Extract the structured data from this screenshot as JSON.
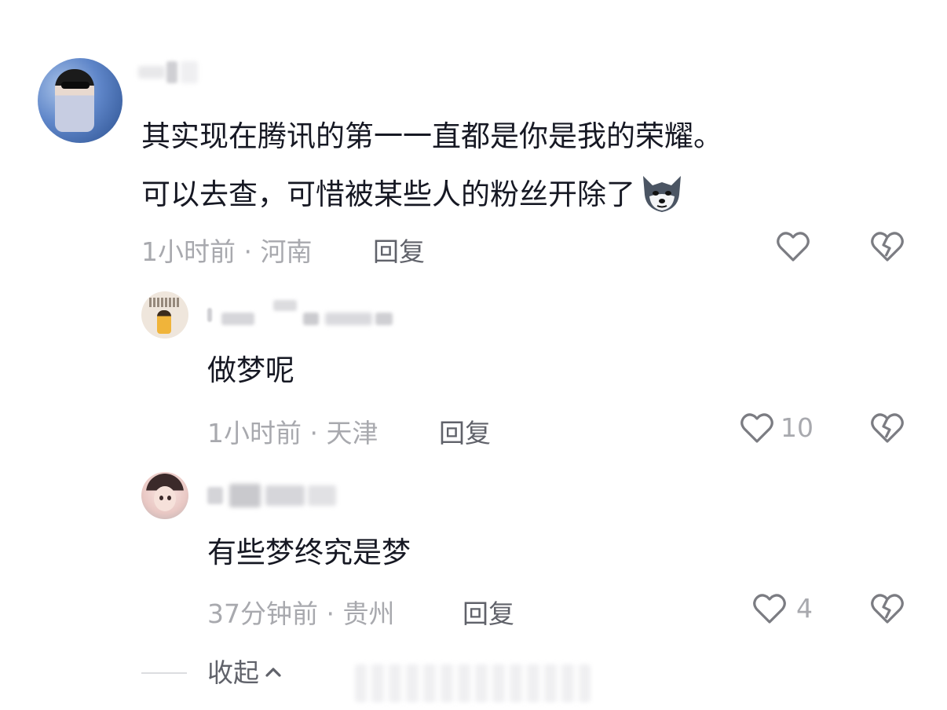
{
  "comments": [
    {
      "text_line1": "其实现在腾讯的第一一直都是你是我的荣耀。",
      "text_line2": "可以去查，可惜被某些人的粉丝开除了",
      "emoji": "wolf-face-emoji",
      "meta": "1小时前 · 河南",
      "reply_label": "回复",
      "like_count": ""
    }
  ],
  "replies": [
    {
      "text": "做梦呢",
      "meta": "1小时前 · 天津",
      "reply_label": "回复",
      "like_count": "10"
    },
    {
      "text": "有些梦终究是梦",
      "meta": "37分钟前 · 贵州",
      "reply_label": "回复",
      "like_count": "4"
    }
  ],
  "footer": {
    "collapse_label": "收起"
  },
  "icons": {
    "like": "heart-outline-icon",
    "dislike": "broken-heart-icon",
    "collapse": "chevron-up-icon"
  },
  "colors": {
    "text_primary": "#161823",
    "text_meta": "#a8a9ae",
    "text_action": "#60626a",
    "icon_stroke": "#7b7c82"
  }
}
